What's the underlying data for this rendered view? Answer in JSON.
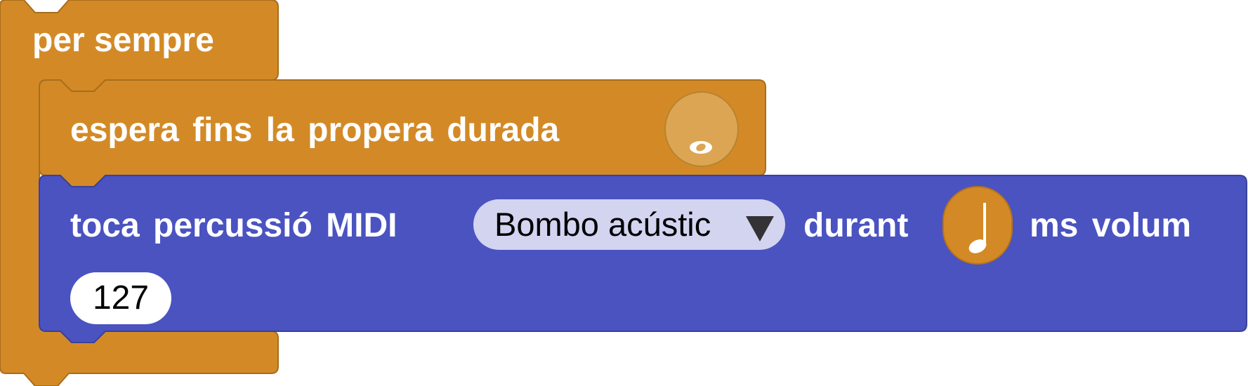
{
  "workspace": {
    "colors": {
      "control": "#d38a26",
      "control_border": "#a86d1c",
      "midi": "#4a53c0",
      "midi_border": "#3a419a",
      "dropdown_bg": "#d2d4f0",
      "field_bg": "#ffffff"
    }
  },
  "forever_block": {
    "label": "per sempre"
  },
  "wait_block": {
    "label": "espera fins la propera durada",
    "duration_icon": "whole-note-icon"
  },
  "midi_block": {
    "label_play": "toca percussió MIDI",
    "instrument": "Bombo acústic",
    "label_during": "durant",
    "duration_icon": "quarter-note-icon",
    "label_ms_volume": "ms volum",
    "volume": "127"
  }
}
